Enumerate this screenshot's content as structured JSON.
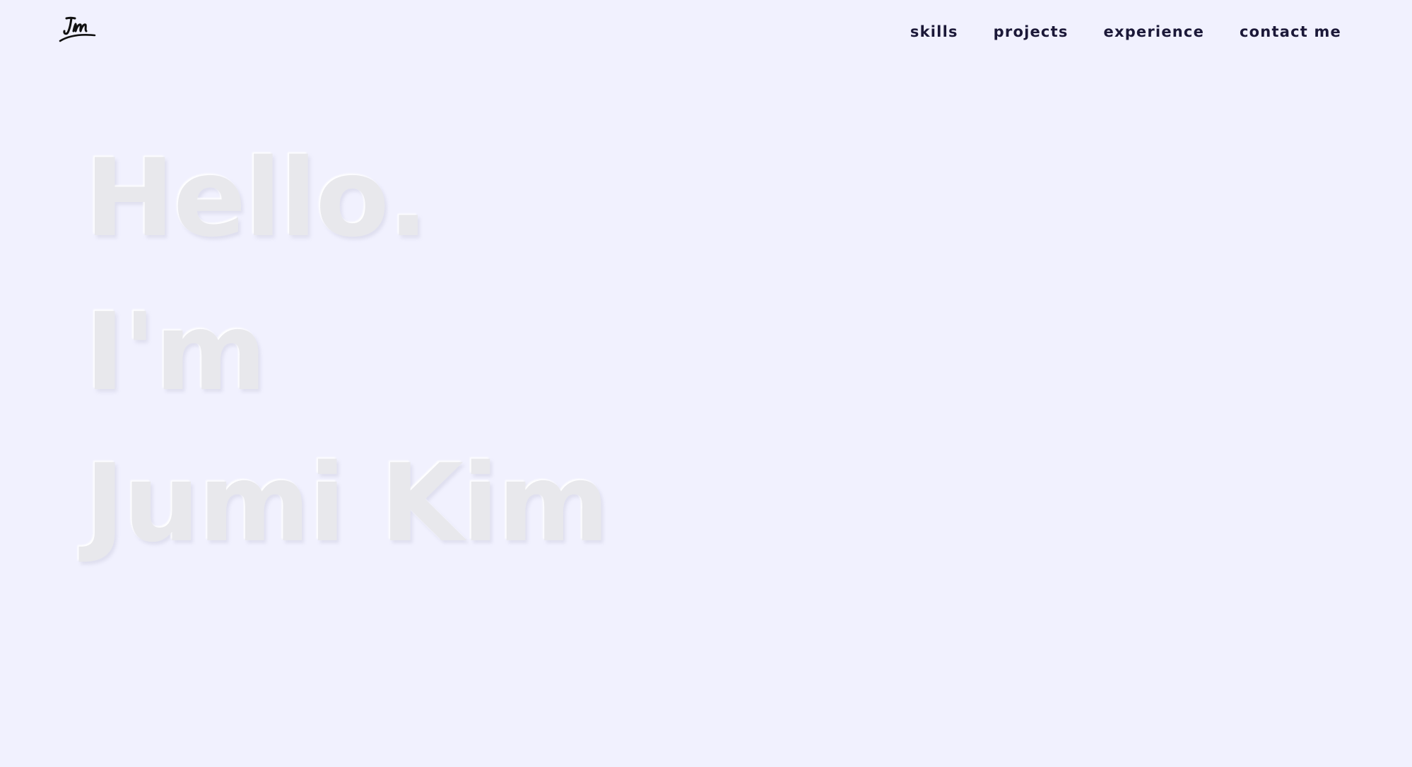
{
  "header": {
    "logo_alt": "JM",
    "nav": [
      {
        "label": "skills"
      },
      {
        "label": "projects"
      },
      {
        "label": "experience"
      },
      {
        "label": "contact me"
      }
    ]
  },
  "hero": {
    "line1": "Hello.",
    "line2": "I'm",
    "line3": "Jumi Kim"
  },
  "colors": {
    "background": "#f1f1fe",
    "nav_text": "#1b1838",
    "hero_text": "#e8e8ec"
  }
}
